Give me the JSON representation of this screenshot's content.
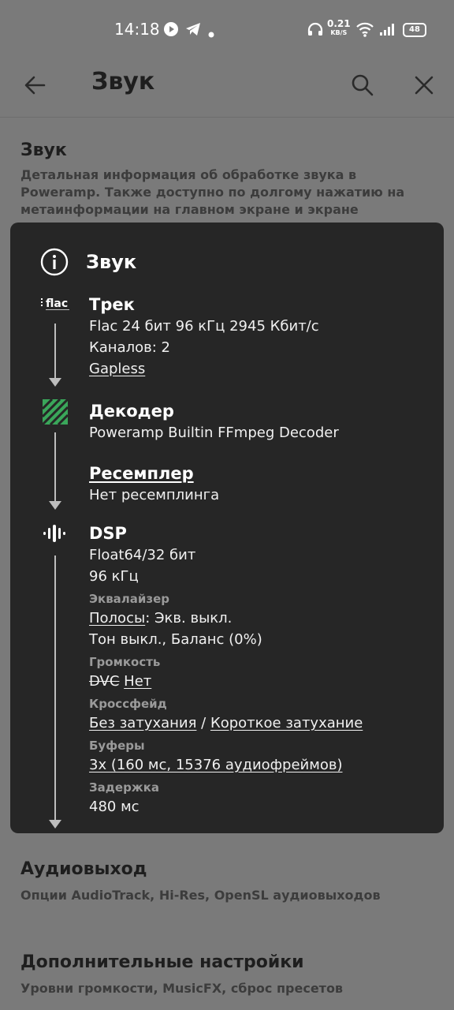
{
  "status_bar": {
    "time": "14:18",
    "speed_value": "0.21",
    "speed_unit": "KB/S",
    "battery": "48",
    "icons": [
      "play-icon",
      "telegram-icon",
      "dot-icon",
      "headphones-icon",
      "wifi-icon",
      "signal-icon",
      "battery-icon"
    ]
  },
  "app_bar": {
    "title": "Звук",
    "icons": [
      "back-arrow-icon",
      "search-icon",
      "close-icon"
    ]
  },
  "background": {
    "section1": {
      "title": "Звук",
      "description": "Детальная информация об обработке звука в Poweramp. Также доступно по долгому нажатию на метаинформации на главном экране и экране"
    },
    "section2": {
      "title": "Аудиовыход",
      "description": "Опции AudioTrack, Hi-Res, OpenSL аудиовыходов"
    },
    "section3": {
      "title": "Дополнительные настройки",
      "description": "Уровни громкости, MusicFX, сброс пресетов"
    }
  },
  "dialog": {
    "title": "Звук",
    "track": {
      "title": "Трек",
      "format": "Flac 24 бит 96 кГц 2945 Кбит/с",
      "channels": "Каналов: 2",
      "gapless": "Gapless",
      "icon_text": "flac"
    },
    "decoder": {
      "title": "Декодер",
      "value": "Poweramp Builtin FFmpeg Decoder"
    },
    "resampler": {
      "title": "Ресемплер",
      "value": "Нет ресемплинга"
    },
    "dsp": {
      "title": "DSP",
      "format": "Float64/32 бит",
      "rate": "96 кГц",
      "eq_label": "Эквалайзер",
      "eq_bands_link": "Полосы",
      "eq_bands_rest": ": Экв. выкл.",
      "eq_tone": "Тон выкл., Баланс (0%)",
      "volume_label": "Громкость",
      "volume_dvc": "DVC",
      "volume_value": "Нет",
      "crossfade_label": "Кроссфейд",
      "crossfade_none": "Без затухания",
      "crossfade_sep": " / ",
      "crossfade_short": "Короткое затухание",
      "buffers_label": "Буферы",
      "buffers_value": "3x (160 мс, 15376 аудиофреймов)",
      "latency_label": "Задержка",
      "latency_value": "480 мс"
    }
  },
  "colors": {
    "scrim": "#7a7a7a",
    "dialog_bg": "#262626",
    "ffmpeg_green": "#3aa65a"
  }
}
